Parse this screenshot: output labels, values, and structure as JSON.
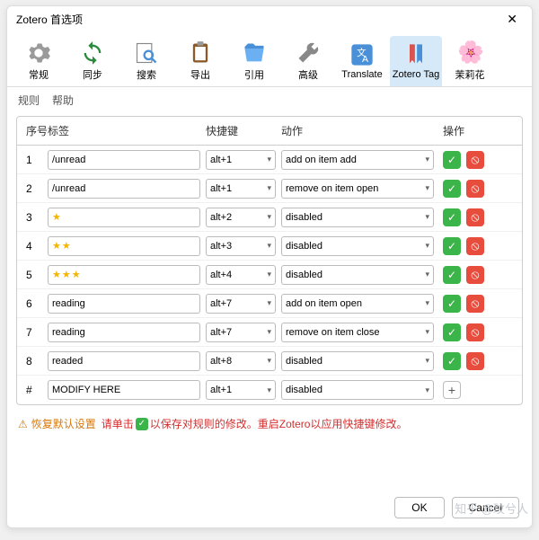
{
  "title": "Zotero 首选项",
  "toolbar": [
    {
      "label": "常规",
      "icon": "gear"
    },
    {
      "label": "同步",
      "icon": "sync"
    },
    {
      "label": "搜索",
      "icon": "search"
    },
    {
      "label": "导出",
      "icon": "clipboard"
    },
    {
      "label": "引用",
      "icon": "folder"
    },
    {
      "label": "高级",
      "icon": "wrench"
    },
    {
      "label": "Translate",
      "icon": "translate"
    },
    {
      "label": "Zotero Tag",
      "icon": "bookmark",
      "active": true
    },
    {
      "label": "茉莉花",
      "icon": "flower"
    }
  ],
  "subtabs": {
    "rules": "规则",
    "help": "帮助"
  },
  "columns": {
    "seq": "序号",
    "tag": "标签",
    "hotkey": "快捷键",
    "action": "动作",
    "ops": "操作"
  },
  "rows": [
    {
      "seq": "1",
      "tag_type": "text",
      "tag": "/unread",
      "hotkey": "alt+1",
      "action": "add on item add",
      "ops": "edit"
    },
    {
      "seq": "2",
      "tag_type": "text",
      "tag": "/unread",
      "hotkey": "alt+1",
      "action": "remove on item open",
      "ops": "edit"
    },
    {
      "seq": "3",
      "tag_type": "stars",
      "stars": 1,
      "hotkey": "alt+2",
      "action": "disabled",
      "ops": "edit"
    },
    {
      "seq": "4",
      "tag_type": "stars",
      "stars": 2,
      "hotkey": "alt+3",
      "action": "disabled",
      "ops": "edit"
    },
    {
      "seq": "5",
      "tag_type": "stars",
      "stars": 3,
      "hotkey": "alt+4",
      "action": "disabled",
      "ops": "edit"
    },
    {
      "seq": "6",
      "tag_type": "text",
      "tag": "reading",
      "hotkey": "alt+7",
      "action": "add on item open",
      "ops": "edit"
    },
    {
      "seq": "7",
      "tag_type": "text",
      "tag": "reading",
      "hotkey": "alt+7",
      "action": "remove on item close",
      "ops": "edit"
    },
    {
      "seq": "8",
      "tag_type": "text",
      "tag": "readed",
      "hotkey": "alt+8",
      "action": "disabled",
      "ops": "edit"
    },
    {
      "seq": "#",
      "tag_type": "text",
      "tag": "MODIFY HERE",
      "hotkey": "alt+1",
      "action": "disabled",
      "ops": "add"
    }
  ],
  "hints": {
    "restore": "恢复默认设置",
    "msg1": "请单击",
    "msg2": "以保存对规则的修改。重启Zotero以应用快捷键修改。"
  },
  "footer": {
    "ok": "OK",
    "cancel": "Cancel"
  },
  "watermark": "知乎 @玟兮人"
}
